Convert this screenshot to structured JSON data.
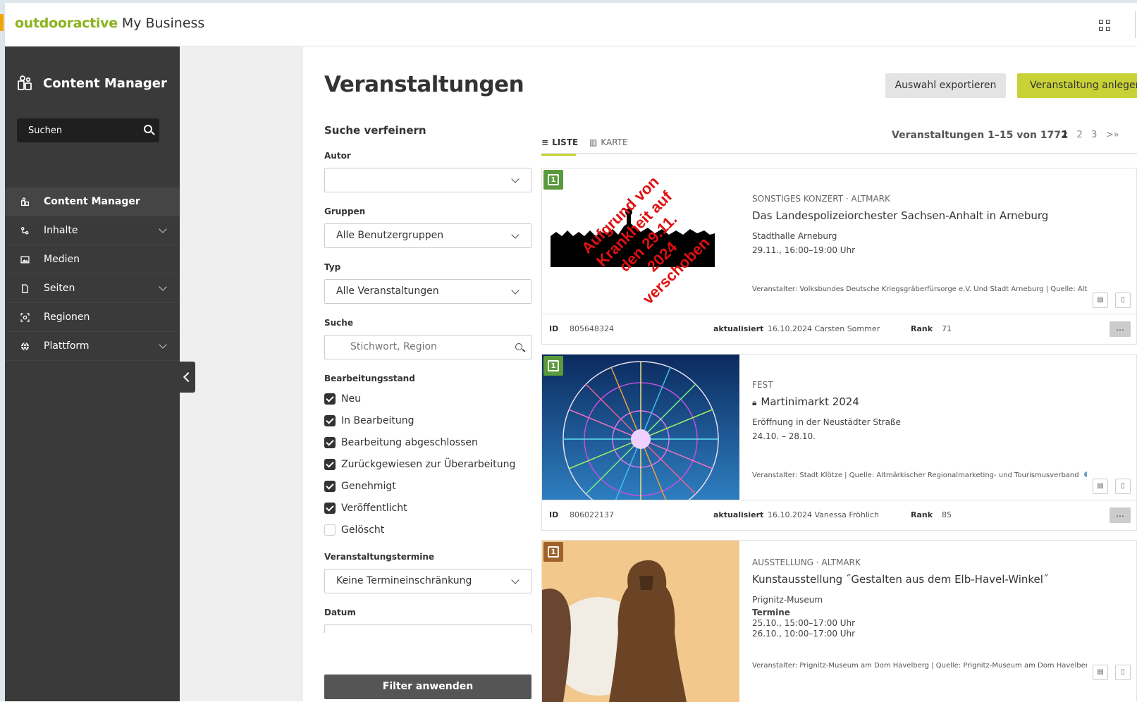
{
  "topbar": {
    "brand_part1": "outdooractive",
    "brand_part2": "My Business"
  },
  "sidebar": {
    "title": "Content Manager",
    "search_placeholder": "Suchen",
    "items": [
      {
        "label": "Content Manager",
        "icon": "content-manager-icon"
      },
      {
        "label": "Inhalte",
        "icon": "content-icon"
      },
      {
        "label": "Medien",
        "icon": "media-icon"
      },
      {
        "label": "Seiten",
        "icon": "pages-icon"
      },
      {
        "label": "Regionen",
        "icon": "regions-icon"
      },
      {
        "label": "Plattform",
        "icon": "platform-icon"
      }
    ]
  },
  "page": {
    "title": "Veranstaltungen",
    "export_label": "Auswahl exportieren",
    "create_label": "Veranstaltung anlegen"
  },
  "filters": {
    "title": "Suche verfeinern",
    "author_label": "Autor",
    "author_value": "",
    "groups_label": "Gruppen",
    "groups_value": "Alle Benutzergruppen",
    "type_label": "Typ",
    "type_value": "Alle Veranstaltungen",
    "search_label": "Suche",
    "search_placeholder": "Stichwort, Region",
    "status_label": "Bearbeitungsstand",
    "status": [
      {
        "label": "Neu",
        "checked": true
      },
      {
        "label": "In Bearbeitung",
        "checked": true
      },
      {
        "label": "Bearbeitung abgeschlossen",
        "checked": true
      },
      {
        "label": "Zurückgewiesen zur Überarbeitung",
        "checked": true
      },
      {
        "label": "Genehmigt",
        "checked": true
      },
      {
        "label": "Veröffentlicht",
        "checked": true
      },
      {
        "label": "Gelöscht",
        "checked": false
      }
    ],
    "dates_label": "Veranstaltungstermine",
    "dates_value": "Keine Termineinschränkung",
    "date_label": "Datum",
    "apply_label": "Filter anwenden"
  },
  "results": {
    "tab_list": "LISTE",
    "tab_map": "KARTE",
    "count": "Veranstaltungen 1–15 von 1772",
    "pages": [
      "1",
      "2",
      "3"
    ],
    "next": ">»"
  },
  "cards": [
    {
      "category": "SONSTIGES KONZERT · ALTMARK",
      "title": "Das Landespolizeiorchester Sachsen-Anhalt in Arneburg",
      "location": "Stadthalle Arneburg",
      "when": "29.11., 16:00–19:00 Uhr",
      "organizer": "Veranstalter: Volksbundes Deutsche Kriegsgräberfürsorge e.V. Und Stadt Arneburg | Quelle: Altm...",
      "id_label": "ID",
      "id": "805648324",
      "updated_label": "aktualisiert",
      "updated": "16.10.2024 Carsten Sommer",
      "rank_label": "Rank",
      "rank": "71",
      "overlay_text": "Aufgrund von Krankheit auf den 29.11. 2024 verschoben",
      "cal_color": "#5a9a3c"
    },
    {
      "category": "FEST",
      "title": "Martinimarkt 2024",
      "location": "Eröffnung in der Neustädter Straße",
      "when": "24.10. – 28.10.",
      "organizer": "Veranstalter: Stadt Klötze | Quelle: Altmärkischer Regionalmarketing- und Tourismusverband",
      "id_label": "ID",
      "id": "806022137",
      "updated_label": "aktualisiert",
      "updated": "16.10.2024 Vanessa Fröhlich",
      "rank_label": "Rank",
      "rank": "85",
      "cal_color": "#5a9a3c"
    },
    {
      "category": "AUSSTELLUNG · ALTMARK",
      "title": "Kunstausstellung ˝Gestalten aus dem Elb-Havel-Winkel˝",
      "location": "Prignitz-Museum",
      "dates_heading": "Termine",
      "when1": "25.10., 15:00–17:00 Uhr",
      "when2": "26.10., 10:00–17:00 Uhr",
      "organizer": "Veranstalter: Prignitz-Museum am Dom Havelberg | Quelle: Prignitz-Museum am Dom Havelberg",
      "cal_color": "#a0622c"
    }
  ],
  "colors": {
    "accent": "#c8d236",
    "brand_green": "#8bb31d",
    "sidebar": "#3a3a3a"
  }
}
